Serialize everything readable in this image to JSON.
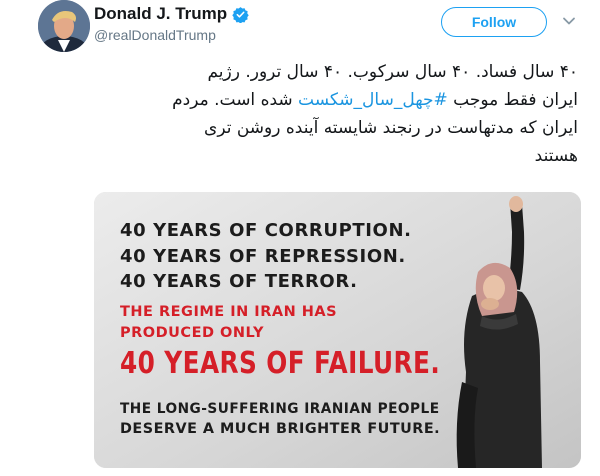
{
  "author": {
    "display_name": "Donald J. Trump",
    "handle": "@realDonaldTrump",
    "avatar_icon": "profile-photo",
    "verified_icon": "verified-badge-icon"
  },
  "actions": {
    "follow_label": "Follow",
    "more_icon": "chevron-down-icon"
  },
  "tweet": {
    "line1": "۴۰ سال فساد. ۴۰ سال سرکوب. ۴۰ سال ترور. رژیم",
    "line2_before": "ایران فقط موجب ",
    "hashtag": "#چهل_سال_شکست",
    "line2_after": " شده است. مردم",
    "line3": "ایران که مدتهاست در رنجند شایسته آینده روشن تری",
    "line4": "هستند"
  },
  "media": {
    "line1": "40 YEARS OF CORRUPTION.",
    "line2": "40 YEARS OF REPRESSION.",
    "line3": "40 YEARS OF TERROR.",
    "line4": "THE REGIME IN IRAN HAS",
    "line5": "PRODUCED ONLY",
    "line6": "40 YEARS OF FAILURE.",
    "line7": "THE LONG-SUFFERING IRANIAN PEOPLE",
    "line8": "DESERVE A MUCH BRIGHTER FUTURE.",
    "accent_red": "#d51f28",
    "link_blue": "#1da1f2"
  }
}
